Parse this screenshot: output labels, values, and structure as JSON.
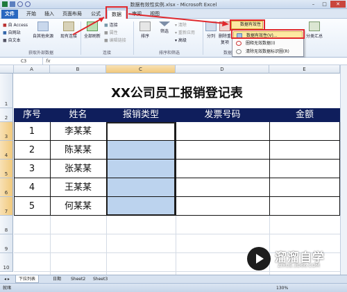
{
  "window": {
    "title": "数据有效性实例.xlsx - Microsoft Excel"
  },
  "tabs": [
    {
      "label": "文件"
    },
    {
      "label": "开始"
    },
    {
      "label": "插入"
    },
    {
      "label": "页面布局"
    },
    {
      "label": "公式"
    },
    {
      "label": "数据"
    },
    {
      "label": "审阅"
    },
    {
      "label": "视图"
    }
  ],
  "ribbon": {
    "ext_data": {
      "access": "自 Access",
      "web": "自网站",
      "text": "自文本",
      "other": "自其他来源",
      "existing": "现有连接",
      "label": "获取外部数据"
    },
    "connections": {
      "refresh": "全部刷新",
      "connect": "连接",
      "props": "属性",
      "edit": "编辑链接",
      "label": "连接"
    },
    "sort": {
      "sort": "排序",
      "filter": "筛选",
      "clear": "清除",
      "reapply": "重新应用",
      "advanced": "高级",
      "label": "排序和筛选"
    },
    "tools": {
      "split": "分列",
      "dedupe": "删除重复项",
      "label": "数据工具"
    },
    "outline": {
      "subtotal": "分类汇总"
    },
    "data_validation": "数据有效性",
    "menu": [
      {
        "label": "数据有效性(V)..."
      },
      {
        "label": "圈释无效数据(I)"
      },
      {
        "label": "清除无效数据标识圈(R)"
      }
    ]
  },
  "formula_bar": {
    "name_box": "C3",
    "fx": "fx"
  },
  "columns": [
    "A",
    "B",
    "C",
    "D",
    "E"
  ],
  "rows": [
    "1",
    "2",
    "3",
    "4",
    "5",
    "6",
    "7",
    "8",
    "9",
    "10"
  ],
  "sheet": {
    "title": "XX公司员工报销登记表",
    "headers": [
      "序号",
      "姓名",
      "报销类型",
      "发票号码",
      "金额"
    ],
    "data": [
      {
        "no": "1",
        "name": "李某某"
      },
      {
        "no": "2",
        "name": "陈某某"
      },
      {
        "no": "3",
        "name": "张某某"
      },
      {
        "no": "4",
        "name": "王某某"
      },
      {
        "no": "5",
        "name": "何某某"
      }
    ]
  },
  "sheet_tabs": [
    "下拉列表",
    "日期",
    "Sheet2",
    "Sheet3"
  ],
  "status": {
    "ready": "就绪",
    "zoom": "130%"
  },
  "watermark": {
    "text": "溜溜自学",
    "sub": "ZIXUE.3D66.COM"
  },
  "colors": {
    "header_bg": "#0f1e5c",
    "selection": "#bcd3ee",
    "highlight": "#e0282c"
  }
}
